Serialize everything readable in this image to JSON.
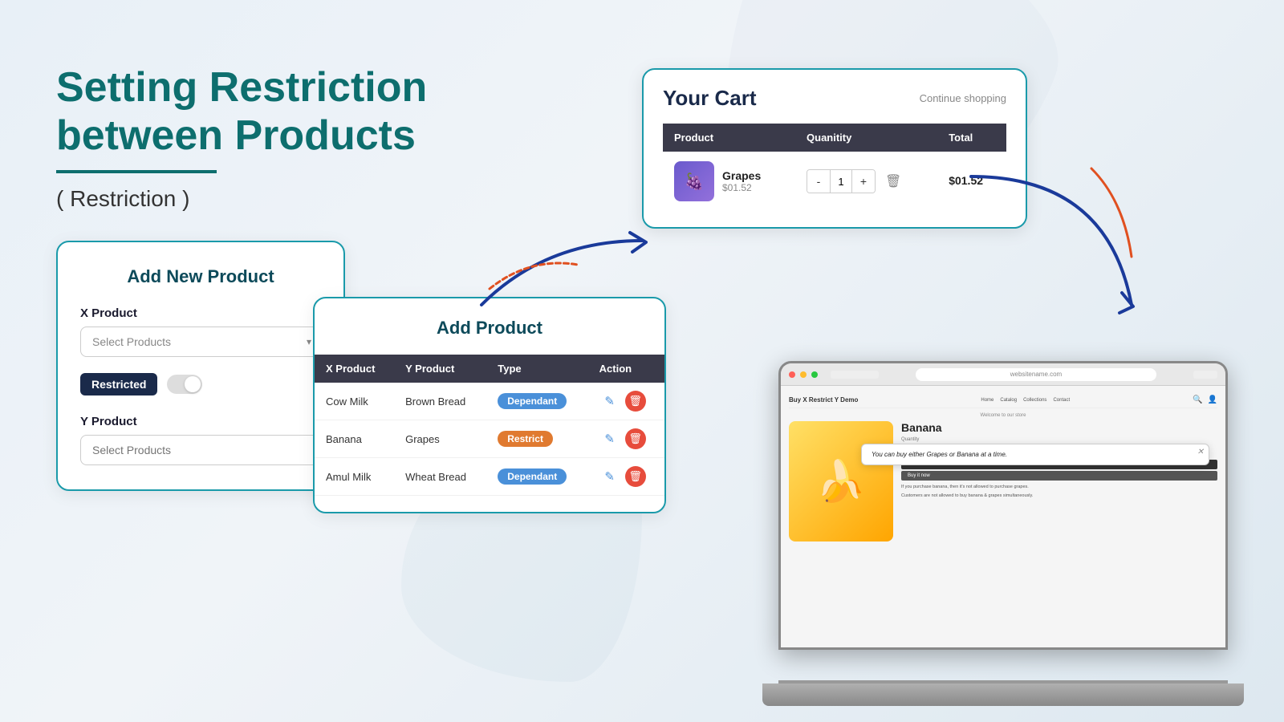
{
  "heading": {
    "title_line1": "Setting Restriction",
    "title_line2": "between Products",
    "subtitle": "( Restriction )"
  },
  "add_new_product_card": {
    "title": "Add New Product",
    "x_product_label": "X Product",
    "x_product_placeholder": "Select Products",
    "toggle_label": "Restricted",
    "y_product_label": "Y Product",
    "y_product_placeholder": "Select Products"
  },
  "add_product_card": {
    "title": "Add Product",
    "table": {
      "headers": [
        "X Product",
        "Y Product",
        "Type",
        "Action"
      ],
      "rows": [
        {
          "x": "Cow Milk",
          "y": "Brown Bread",
          "type": "Dependant",
          "type_class": "dependant"
        },
        {
          "x": "Banana",
          "y": "Grapes",
          "type": "Restrict",
          "type_class": "restrict"
        },
        {
          "x": "Amul Milk",
          "y": "Wheat Bread",
          "type": "Dependant",
          "type_class": "dependant"
        }
      ]
    }
  },
  "cart": {
    "title": "Your Cart",
    "continue_shopping": "Continue shopping",
    "headers": [
      "Product",
      "Quanitity",
      "Total"
    ],
    "items": [
      {
        "name": "Grapes",
        "price": "$01.52",
        "qty": 1,
        "total": "$01.52",
        "emoji": "🍇"
      }
    ]
  },
  "laptop": {
    "url": "websitename.com",
    "store_title": "Welcome to our store",
    "nav_links": [
      "Home",
      "Catalog",
      "Collections",
      "Contact"
    ],
    "product_name": "Banana",
    "popup_text": "You can buy either Grapes or Banana at a time.",
    "restriction_text_1": "If you purchase banana, then it's not allowed to purchase grapes.",
    "restriction_text_2": "Customers are not allowed to buy banana & grapes simultaneously."
  }
}
